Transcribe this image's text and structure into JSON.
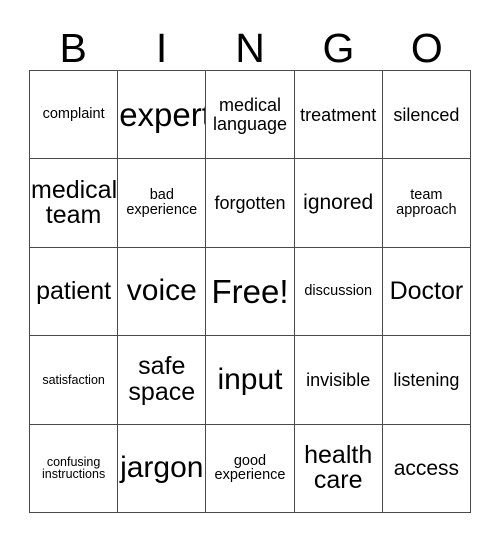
{
  "card": {
    "type": "bingo-card",
    "columns": 5,
    "rows": 5,
    "grid_line_color": "#4a4a4a",
    "background_color": "#ffffff",
    "text_color": "#000000"
  },
  "header": {
    "letters": [
      "B",
      "I",
      "N",
      "G",
      "O"
    ]
  },
  "cells": [
    [
      {
        "text": "complaint",
        "size": "fs-s"
      },
      {
        "text": "expert",
        "size": "fs-xxl"
      },
      {
        "text": "medical\nlanguage",
        "size": "fs-m"
      },
      {
        "text": "treatment",
        "size": "fs-m"
      },
      {
        "text": "silenced",
        "size": "fs-m"
      }
    ],
    [
      {
        "text": "medical\nteam",
        "size": "fs-l"
      },
      {
        "text": "bad\nexperience",
        "size": "fs-s"
      },
      {
        "text": "forgotten",
        "size": "fs-m"
      },
      {
        "text": "ignored",
        "size": "fs-ml"
      },
      {
        "text": "team\napproach",
        "size": "fs-s"
      }
    ],
    [
      {
        "text": "patient",
        "size": "fs-l"
      },
      {
        "text": "voice",
        "size": "fs-xl"
      },
      {
        "text": "Free!",
        "size": "fs-xxl"
      },
      {
        "text": "discussion",
        "size": "fs-s"
      },
      {
        "text": "Doctor",
        "size": "fs-l"
      }
    ],
    [
      {
        "text": "satisfaction",
        "size": "fs-xs"
      },
      {
        "text": "safe\nspace",
        "size": "fs-l"
      },
      {
        "text": "input",
        "size": "fs-xl"
      },
      {
        "text": "invisible",
        "size": "fs-m"
      },
      {
        "text": "listening",
        "size": "fs-m"
      }
    ],
    [
      {
        "text": "confusing\ninstructions",
        "size": "fs-xs"
      },
      {
        "text": "jargon",
        "size": "fs-xl"
      },
      {
        "text": "good\nexperience",
        "size": "fs-s"
      },
      {
        "text": "health\ncare",
        "size": "fs-l"
      },
      {
        "text": "access",
        "size": "fs-ml"
      }
    ]
  ]
}
